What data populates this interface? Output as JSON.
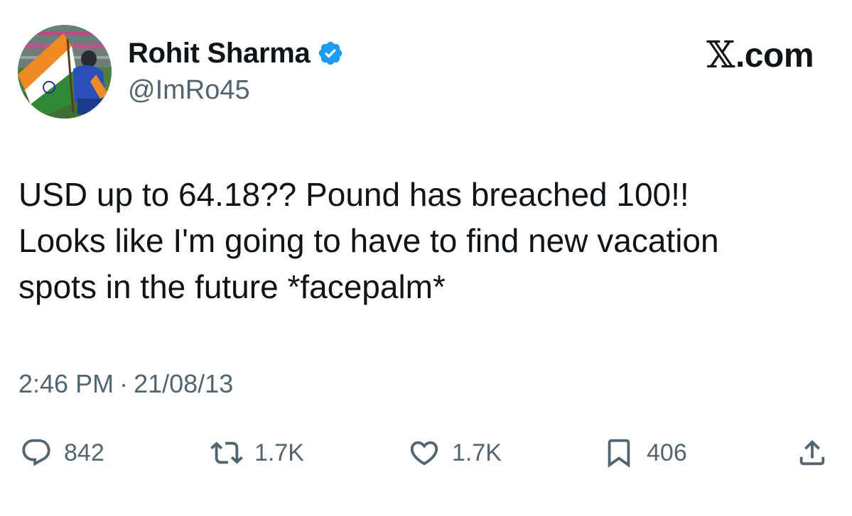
{
  "author": {
    "display_name": "Rohit Sharma",
    "handle": "@ImRo45",
    "verified": true,
    "verified_color": "#1d9bf0",
    "avatar_icon": "profile-photo-with-indian-flag"
  },
  "brand": {
    "x_glyph": "𝕏",
    "domain": ".com"
  },
  "tweet": {
    "lines": [
      "USD up to 64.18?? Pound has breached 100!!",
      "Looks like I'm going to have to find new vacation",
      "spots in the future *facepalm*"
    ],
    "time": "2:46 PM",
    "separator": "·",
    "date": "21/08/13"
  },
  "metrics": {
    "replies": "842",
    "reposts": "1.7K",
    "likes": "1.7K",
    "bookmarks": "406"
  },
  "icons": {
    "reply": "reply-icon",
    "repost": "repost-icon",
    "like": "heart-icon",
    "bookmark": "bookmark-icon",
    "share": "share-icon"
  },
  "colors": {
    "text": "#0f1419",
    "secondary": "#536471",
    "verified": "#1d9bf0"
  }
}
